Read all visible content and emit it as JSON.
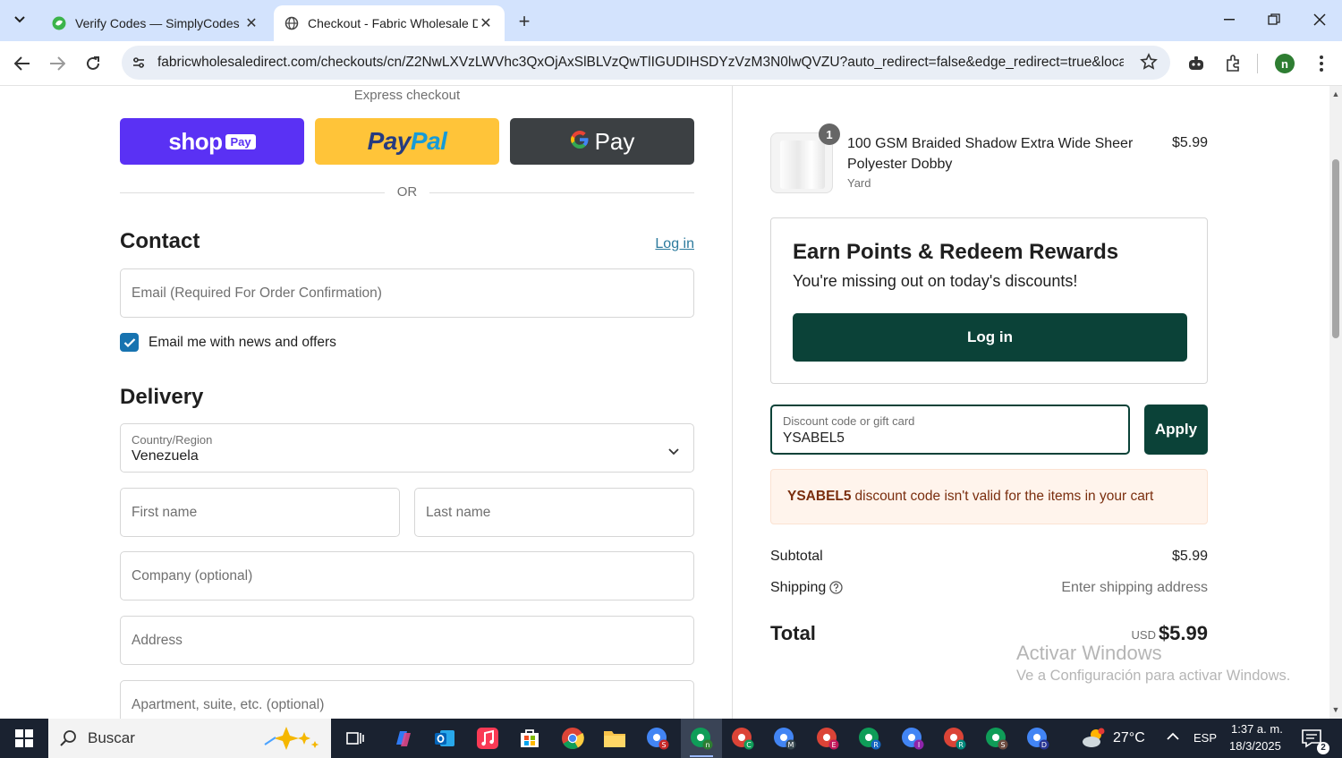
{
  "browser": {
    "tabs": [
      {
        "title": "Verify Codes — SimplyCodes",
        "active": false
      },
      {
        "title": "Checkout - Fabric Wholesale Di",
        "active": true
      }
    ],
    "url": "fabricwholesaledirect.com/checkouts/cn/Z2NwLXVzLWVhc3QxOjAxSlBLVzQwTlIGUDIHSDYzVzM3N0lwQVZU?auto_redirect=false&edge_redirect=true&locale...",
    "profile_initial": "n"
  },
  "checkout": {
    "express_label": "Express checkout",
    "shop_pay": {
      "word": "shop",
      "badge": "Pay"
    },
    "paypal": {
      "part1": "Pay",
      "part2": "Pal"
    },
    "gpay": {
      "word": "Pay"
    },
    "or_text": "OR",
    "contact": {
      "title": "Contact",
      "login_link": "Log in",
      "email_placeholder": "Email (Required For Order Confirmation)",
      "newsletter_label": "Email me with news and offers",
      "newsletter_checked": true
    },
    "delivery": {
      "title": "Delivery",
      "country_label": "Country/Region",
      "country_value": "Venezuela",
      "first_name_placeholder": "First name",
      "last_name_placeholder": "Last name",
      "company_placeholder": "Company (optional)",
      "address_placeholder": "Address",
      "apartment_placeholder": "Apartment, suite, etc. (optional)"
    }
  },
  "summary": {
    "item": {
      "quantity": "1",
      "name": "100 GSM Braided Shadow Extra Wide Sheer Polyester Dobby",
      "variant": "Yard",
      "price": "$5.99"
    },
    "rewards": {
      "title": "Earn Points & Redeem Rewards",
      "subtitle": "You're missing out on today's discounts!",
      "login_button": "Log in"
    },
    "discount": {
      "label": "Discount code or gift card",
      "value": "YSABEL5",
      "apply_button": "Apply",
      "error_code": "YSABEL5",
      "error_text": "discount code isn't valid for the items in your cart"
    },
    "subtotal_label": "Subtotal",
    "subtotal_value": "$5.99",
    "shipping_label": "Shipping",
    "shipping_value": "Enter shipping address",
    "total_label": "Total",
    "total_currency": "USD",
    "total_value": "$5.99"
  },
  "watermark": {
    "line1": "Activar Windows",
    "line2": "Ve a Configuración para activar Windows."
  },
  "taskbar": {
    "search_label": "Buscar",
    "weather": "27°C",
    "language": "ESP",
    "time": "1:37 a. m.",
    "date": "18/3/2025",
    "notification_count": "2"
  },
  "colors": {
    "accent_dark_green": "#0b4238",
    "shop_purple": "#5a31f4",
    "paypal_yellow": "#ffc439",
    "gpay_dark": "#3c4043",
    "link_blue": "#2c7a9d",
    "error_bg": "#fff4ec"
  },
  "icons": [
    "search-icon",
    "back-icon",
    "forward-icon",
    "reload-icon",
    "site-info-icon",
    "star-icon",
    "extension-icon",
    "windows-start-icon"
  ]
}
